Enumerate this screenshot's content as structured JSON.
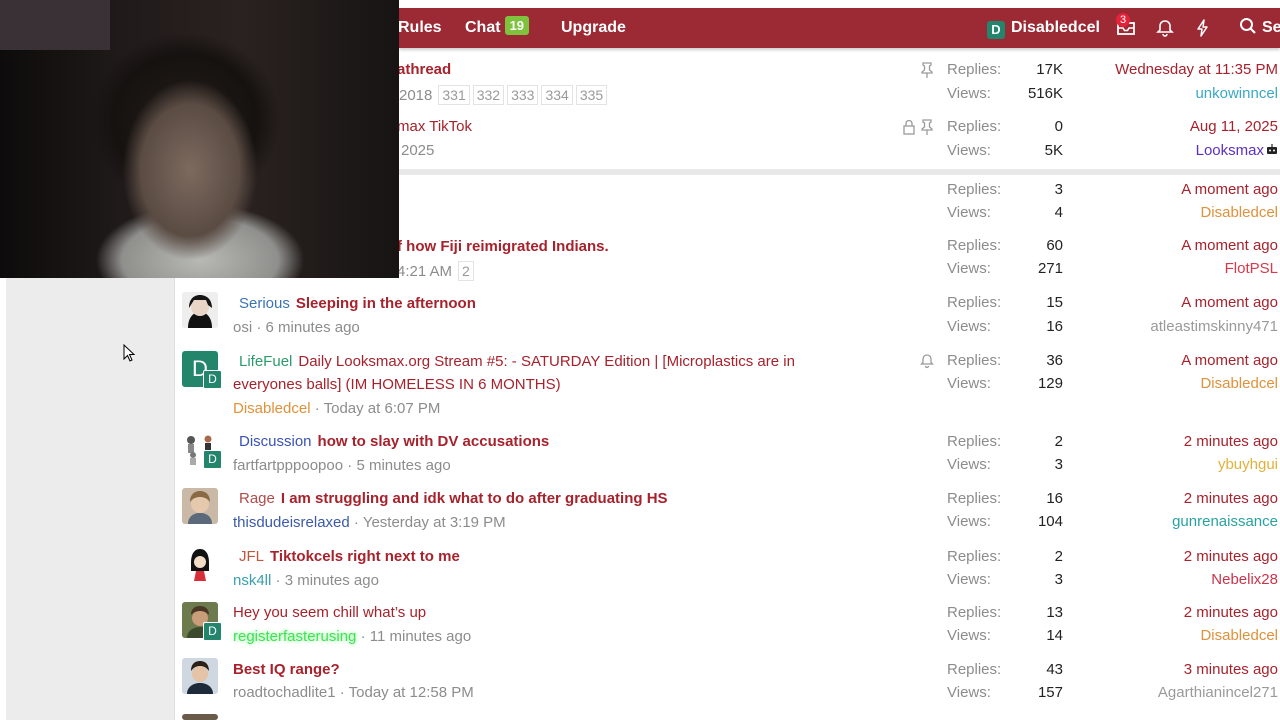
{
  "nav": {
    "rules": "Rules",
    "chat": "Chat",
    "chat_count": "19",
    "upgrade": "Upgrade",
    "user_initial": "D",
    "username": "Disabledcel",
    "inbox_count": "3",
    "search": "Se"
  },
  "colors": {
    "nav_bg": "#9b2a35",
    "title": "#a6222c",
    "chat_badge": "#7ec23e",
    "avatar_teal": "#24856d"
  },
  "threads": [
    {
      "title": "athread",
      "start": "2018",
      "pages": [
        "331",
        "332",
        "333",
        "334",
        "335"
      ],
      "replies_label": "Replies:",
      "replies": "17K",
      "views_label": "Views:",
      "views": "516K",
      "last_date": "Wednesday at 11:35 PM",
      "last_user": "unkowinncel"
    },
    {
      "title": "max TikTok",
      "start": "2025",
      "replies_label": "Replies:",
      "replies": "0",
      "views_label": "Views:",
      "views": "5K",
      "last_date": "Aug 11, 2025",
      "last_user": "Looksmax"
    },
    {
      "replies_label": "Replies:",
      "replies": "3",
      "views_label": "Views:",
      "views": "4",
      "last_date": "A moment ago",
      "last_user": "Disabledcel"
    },
    {
      "title": "f how Fiji reimigrated Indians.",
      "start": "4:21 AM",
      "pages": [
        "2"
      ],
      "replies_label": "Replies:",
      "replies": "60",
      "views_label": "Views:",
      "views": "271",
      "last_date": "A moment ago",
      "last_user": "FlotPSL"
    },
    {
      "prefix": "Serious",
      "title": "Sleeping in the afternoon",
      "author": "osi",
      "start": "6 minutes ago",
      "replies_label": "Replies:",
      "replies": "15",
      "views_label": "Views:",
      "views": "16",
      "last_date": "A moment ago",
      "last_user": "atleastimskinny471"
    },
    {
      "prefix": "LifeFuel",
      "title": "Daily Looksmax.org Stream #5: - SATURDAY Edition | [Microplastics are in",
      "title2": "everyones balls] (IM HOMELESS IN 6 MONTHS)",
      "author": "Disabledcel",
      "start": "Today at 6:07 PM",
      "avatar_letter": "D",
      "badge": "D",
      "replies_label": "Replies:",
      "replies": "36",
      "views_label": "Views:",
      "views": "129",
      "last_date": "A moment ago",
      "last_user": "Disabledcel"
    },
    {
      "prefix": "Discussion",
      "title": "how to slay with DV accusations",
      "author": "fartfartpppoopoo",
      "start": "5 minutes ago",
      "badge": "D",
      "replies_label": "Replies:",
      "replies": "2",
      "views_label": "Views:",
      "views": "3",
      "last_date": "2 minutes ago",
      "last_user": "ybuyhgui"
    },
    {
      "prefix": "Rage",
      "title": "I am struggling and idk what to do after graduating HS",
      "author": "thisdudeisrelaxed",
      "start": "Yesterday at 3:19 PM",
      "replies_label": "Replies:",
      "replies": "16",
      "views_label": "Views:",
      "views": "104",
      "last_date": "2 minutes ago",
      "last_user": "gunrenaissance"
    },
    {
      "prefix": "JFL",
      "title": "Tiktokcels right next to me",
      "author": "nsk4ll",
      "start": "3 minutes ago",
      "replies_label": "Replies:",
      "replies": "2",
      "views_label": "Views:",
      "views": "3",
      "last_date": "2 minutes ago",
      "last_user": "Nebelix28"
    },
    {
      "title": "Hey you seem chill what’s up",
      "author": "registerfasterusing",
      "start": "11 minutes ago",
      "badge": "D",
      "replies_label": "Replies:",
      "replies": "13",
      "views_label": "Views:",
      "views": "14",
      "last_date": "2 minutes ago",
      "last_user": "Disabledcel"
    },
    {
      "title": "Best IQ range?",
      "author": "roadtochadlite1",
      "start": "Today at 12:58 PM",
      "replies_label": "Replies:",
      "replies": "43",
      "views_label": "Views:",
      "views": "157",
      "last_date": "3 minutes ago",
      "last_user": "Agarthianincel271"
    }
  ]
}
